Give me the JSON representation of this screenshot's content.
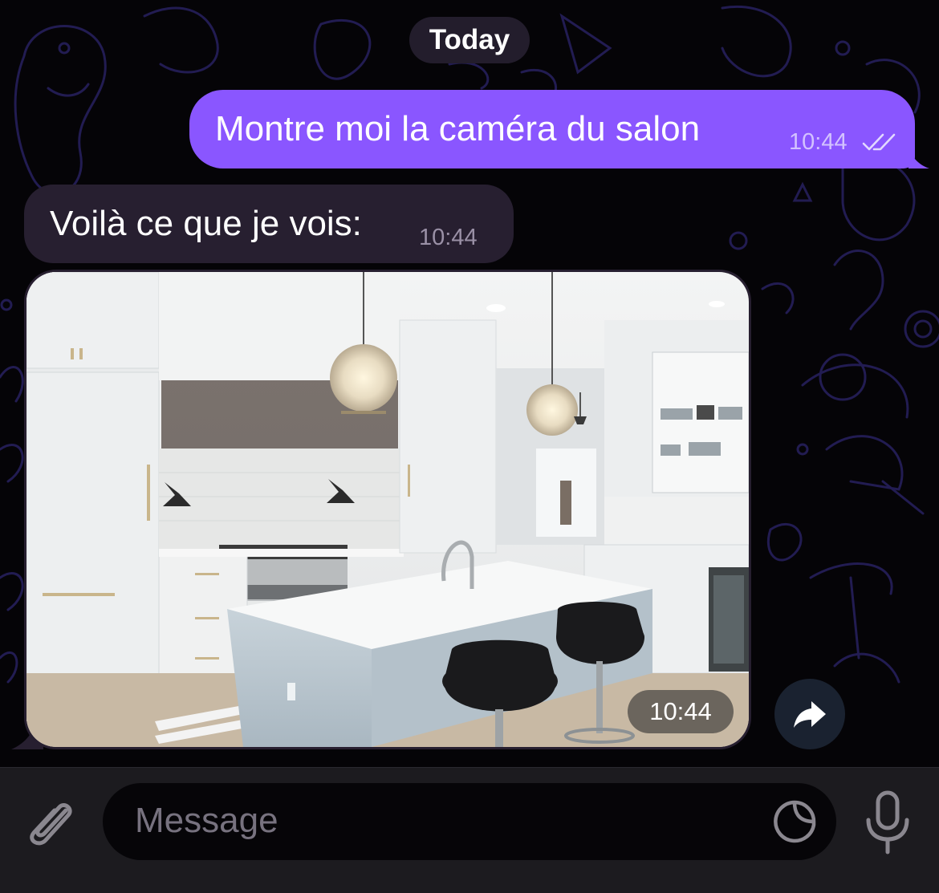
{
  "theme": {
    "accent": "#8a56ff",
    "incoming_bubble": "#271f30",
    "background": "#050407",
    "doodle_color": "#221c52"
  },
  "chat": {
    "date_separator": "Today",
    "messages": [
      {
        "direction": "outgoing",
        "text": "Montre moi la caméra du salon",
        "time": "10:44",
        "status_icon": "double-check-icon"
      },
      {
        "direction": "incoming",
        "text": "Voilà ce que je vois:",
        "time": "10:44"
      },
      {
        "direction": "incoming",
        "type": "photo",
        "photo_subject": "white kitchen with island, pendant lamps and black bar stools",
        "time": "10:44",
        "action_icon": "forward-icon"
      }
    ]
  },
  "composer": {
    "placeholder": "Message",
    "attach_icon": "paperclip-icon",
    "sticker_icon": "sticker-icon",
    "mic_icon": "microphone-icon"
  }
}
